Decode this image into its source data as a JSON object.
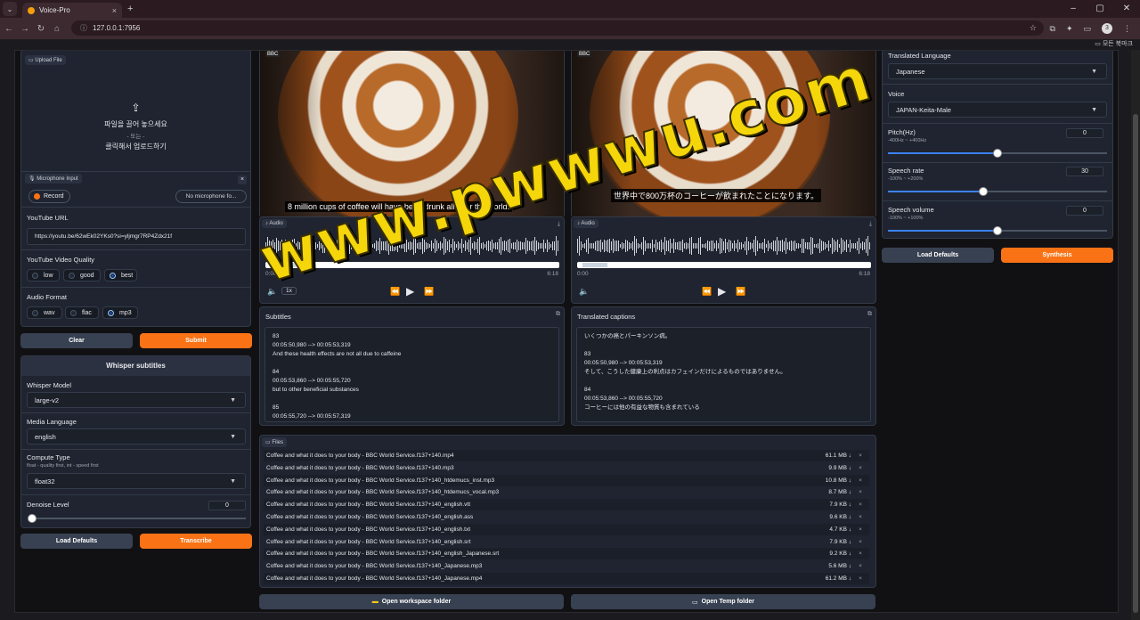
{
  "browser": {
    "tab_title": "Voice-Pro",
    "url": "127.0.0.1:7956",
    "bookmarks_label": "모든 북마크",
    "profile_initial": "3"
  },
  "left": {
    "upload": {
      "label": "Upload File",
      "drop_line1": "파일을 끌어 놓으세요",
      "drop_line2": "- 또는 -",
      "drop_line3": "클릭해서 업로드하기"
    },
    "mic": {
      "label": "Microphone Input",
      "record": "Record",
      "device": "No microphone fo..."
    },
    "youtube_url": {
      "label": "YouTube URL",
      "value": "https://youtu.be/62wEk02YKs0?si=yljmgr7RP4Zdx21f"
    },
    "quality": {
      "label": "YouTube Video Quality",
      "options": [
        "low",
        "good",
        "best"
      ],
      "selected": "best"
    },
    "audio_format": {
      "label": "Audio Format",
      "options": [
        "wav",
        "flac",
        "mp3"
      ],
      "selected": "mp3"
    },
    "clear": "Clear",
    "submit": "Submit",
    "whisper": {
      "title": "Whisper subtitles",
      "model_label": "Whisper Model",
      "model": "large-v2",
      "lang_label": "Media Language",
      "lang": "english",
      "compute_label": "Compute Type",
      "compute_hint": "float - quality first, int - speed first",
      "compute": "float32",
      "denoise_label": "Denoise Level",
      "denoise": "0",
      "load_defaults": "Load Defaults",
      "transcribe": "Transcribe"
    }
  },
  "middle": {
    "caption_en": "8 million cups of coffee will have been drunk all over the world.",
    "audio_label": "Audio",
    "time_start": "0:00",
    "time_end": "6:18",
    "speed": "1x",
    "subtitles_label": "Subtitles",
    "subtitles_text": "83\n00:05:50,980 --> 00:05:53,319\nAnd these health effects are not all due to caffeine\n\n84\n00:05:53,860 --> 00:05:55,720\nbut to other beneficial substances\n\n85\n00:05:55,720 --> 00:05:57,319"
  },
  "right": {
    "caption_ja": "世界中で800万杯のコーヒーが飲まれたことになります。",
    "audio_label": "Audio",
    "time_start": "0:00",
    "time_end": "6:18",
    "translated_label": "Translated captions",
    "translated_text": "いくつかの癌とパーキンソン病。\n\n83\n00:05:50,980 --> 00:05:53,319\nそして、こうした健康上の利点はカフェインだけによるものではありません。\n\n84\n00:05:53,860 --> 00:05:55,720\nコーヒーには他の有益な物質も含まれている\n\n85"
  },
  "tts": {
    "lang_label": "Translated Language",
    "lang": "Japanese",
    "voice_label": "Voice",
    "voice": "JAPAN-Keita-Male",
    "pitch_label": "Pitch(Hz)",
    "pitch_hint": "-400Hz ~ +400Hz",
    "pitch": "0",
    "pitch_level": 0.5,
    "rate_label": "Speech rate",
    "rate_hint": "-100% ~ +200%",
    "rate": "30",
    "rate_level": 0.433,
    "volume_label": "Speech volume",
    "volume_hint": "-100% ~ +100%",
    "volume": "0",
    "volume_level": 0.5,
    "load_defaults": "Load Defaults",
    "synthesis": "Synthesis"
  },
  "files": {
    "label": "Files",
    "rows": [
      {
        "name": "Coffee and what it does to your body - BBC World Service.f137+140.mp4",
        "size": "61.1 MB ↓"
      },
      {
        "name": "Coffee and what it does to your body - BBC World Service.f137+140.mp3",
        "size": "9.9 MB ↓"
      },
      {
        "name": "Coffee and what it does to your body - BBC World Service.f137+140_htdemucs_inst.mp3",
        "size": "10.8 MB ↓"
      },
      {
        "name": "Coffee and what it does to your body - BBC World Service.f137+140_htdemucs_vocal.mp3",
        "size": "8.7 MB ↓"
      },
      {
        "name": "Coffee and what it does to your body - BBC World Service.f137+140_english.vtt",
        "size": "7.9 KB ↓"
      },
      {
        "name": "Coffee and what it does to your body - BBC World Service.f137+140_english.ass",
        "size": "9.6 KB ↓"
      },
      {
        "name": "Coffee and what it does to your body - BBC World Service.f137+140_english.txt",
        "size": "4.7 KB ↓"
      },
      {
        "name": "Coffee and what it does to your body - BBC World Service.f137+140_english.srt",
        "size": "7.9 KB ↓"
      },
      {
        "name": "Coffee and what it does to your body - BBC World Service.f137+140_english_Japanese.srt",
        "size": "9.2 KB ↓"
      },
      {
        "name": "Coffee and what it does to your body - BBC World Service.f137+140_Japanese.mp3",
        "size": "5.6 MB ↓"
      },
      {
        "name": "Coffee and what it does to your body - BBC World Service.f137+140_Japanese.mp4",
        "size": "61.2 MB ↓"
      }
    ],
    "open_workspace": "Open workspace folder",
    "open_temp": "Open Temp folder"
  },
  "watermark": "www.pwwwu.com"
}
